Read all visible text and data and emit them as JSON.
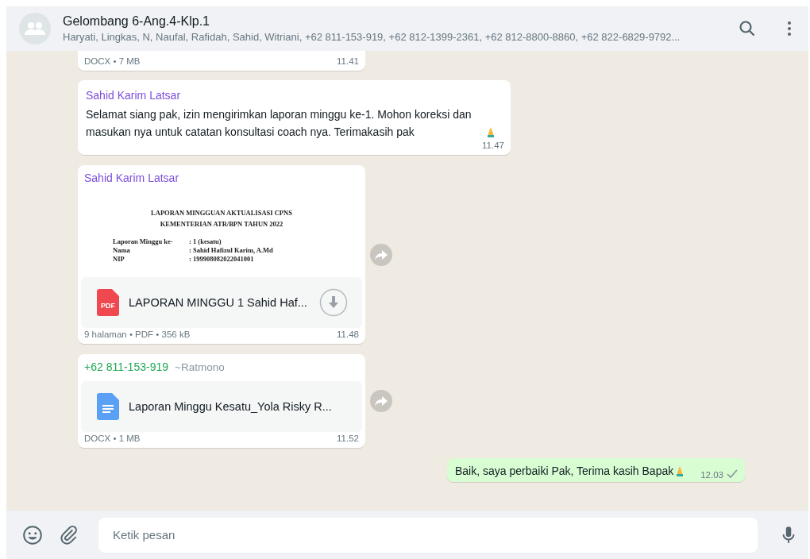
{
  "header": {
    "title": "Gelombang 6-Ang.4-Klp.1",
    "members": "Haryati, Lingkas, N, Naufal, Rafidah, Sahid, Witriani, +62 811-153-919, +62 812-1399-2361, +62 812-8800-8860, +62 822-6829-9792..."
  },
  "messages": [
    {
      "kind": "file_tail",
      "meta": "DOCX • 7 MB",
      "time": "11.41"
    },
    {
      "kind": "text",
      "sender": "Sahid Karim Latsar",
      "text": "Selamat siang pak, izin mengirimkan laporan minggu ke-1. Mohon koreksi dan masukan nya untuk catatan konsultasi coach nya. Terimakasih pak",
      "emoji": true,
      "time": "11.47"
    },
    {
      "kind": "pdf",
      "sender": "Sahid Karim Latsar",
      "preview": {
        "heading": [
          "LAPORAN MINGGUAN AKTUALISASI CPNS",
          "KEMENTERIAN ATR/BPN TAHUN 2022"
        ],
        "rows": [
          [
            "Laporan Minggu ke-",
            ": 1 (kesatu)"
          ],
          [
            "Nama",
            ": Sahid Hafizul Karim, A.Md"
          ],
          [
            "NIP",
            ": 199908082022041001"
          ]
        ]
      },
      "file": "LAPORAN MINGGU 1 Sahid Haf...",
      "type_label": "PDF",
      "meta": "9 halaman • PDF • 356 kB",
      "time": "11.48",
      "forward": true
    },
    {
      "kind": "doc",
      "sender": "+62 811-153-919",
      "alias": "~Ratmono",
      "file": "Laporan Minggu Kesatu_Yola Risky R...",
      "meta": "DOCX • 1 MB",
      "time": "11.52",
      "forward": true
    },
    {
      "kind": "outgoing",
      "text": "Baik, saya perbaiki Pak, Terima kasih Bapak",
      "emoji": true,
      "time": "12.03"
    }
  ],
  "composer": {
    "placeholder": "Ketik pesan"
  }
}
